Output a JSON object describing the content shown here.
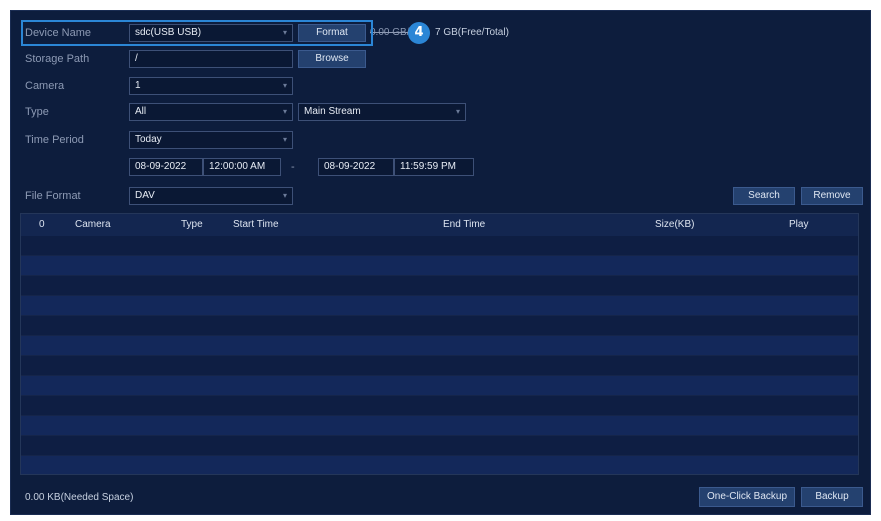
{
  "form": {
    "device_name": {
      "label": "Device Name",
      "value": "sdc(USB USB)",
      "format_button": "Format",
      "capacity": "0.00 GB/",
      "capacity_suffix": "7 GB(Free/Total)"
    },
    "storage_path": {
      "label": "Storage Path",
      "value": "/",
      "browse_button": "Browse"
    },
    "camera": {
      "label": "Camera",
      "value": "1"
    },
    "type": {
      "label": "Type",
      "value": "All",
      "stream_value": "Main Stream"
    },
    "time_period": {
      "label": "Time Period",
      "value": "Today",
      "start_date": "08-09-2022",
      "start_time": "12:00:00 AM",
      "separator": "-",
      "end_date": "08-09-2022",
      "end_time": "11:59:59 PM"
    },
    "file_format": {
      "label": "File Format",
      "value": "DAV"
    }
  },
  "actions": {
    "search": "Search",
    "remove": "Remove"
  },
  "callout": {
    "number": "4"
  },
  "table": {
    "columns": [
      "0",
      "Camera",
      "Type",
      "Start Time",
      "End Time",
      "Size(KB)",
      "Play"
    ],
    "row_count": 12
  },
  "footer": {
    "needed_space": "0.00 KB(Needed Space)",
    "one_click_backup": "One-Click Backup",
    "backup": "Backup"
  },
  "colors": {
    "background": "#0d1d3d",
    "button": "#24416f",
    "highlight": "#2b86d6"
  }
}
